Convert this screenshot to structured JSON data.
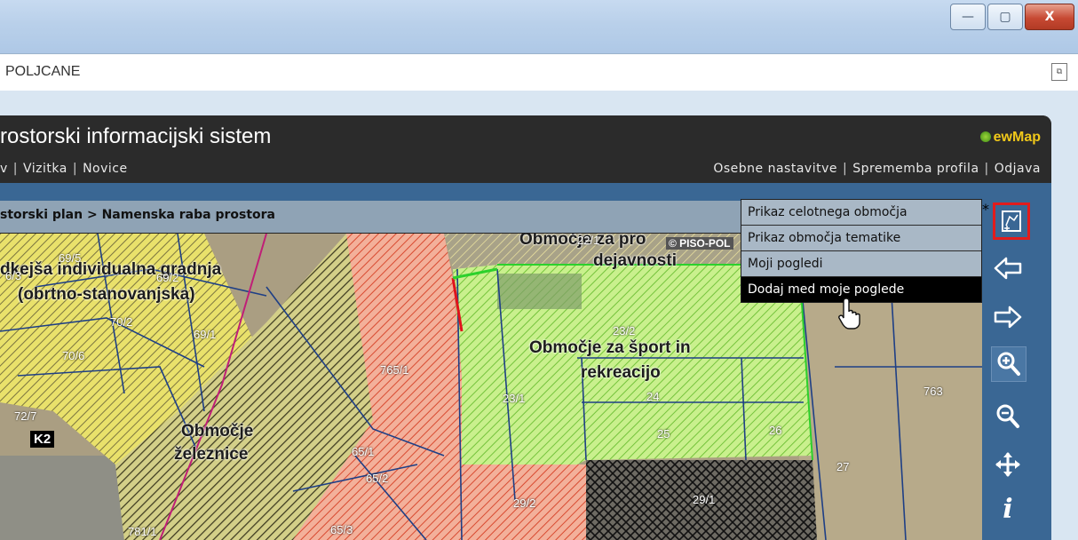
{
  "window": {
    "address": "POLJCANE",
    "minimize": "—",
    "maximize": "▢",
    "close": "X"
  },
  "app": {
    "title": "rostorski informacijski sistem",
    "logo": "ewMap",
    "nav_left": [
      "v",
      "Vizitka",
      "Novice"
    ],
    "nav_right": [
      "Osebne nastavitve",
      "Sprememba profila",
      "Odjava"
    ],
    "breadcrumb": "storski plan > Namenska raba prostora"
  },
  "menu": {
    "items": [
      "Prikaz celotnega območja",
      "Prikaz območja tematike",
      "Moji pogledi",
      "Dodaj med moje poglede"
    ],
    "highlighted": 3
  },
  "map": {
    "zones": {
      "individual": "dkejša individualna gradnja",
      "individual2": "(obrtno-stanovanjska)",
      "sport": "Območje za šport in",
      "sport2": "rekreacijo",
      "railway": "Območje",
      "railway2": "železnice",
      "service": "Območje za pro",
      "service2": "dejavnosti",
      "copyright": "© PISO-POL"
    },
    "parcels": [
      "69/5",
      "6/3",
      "69/2",
      "70/2",
      "69/1",
      "70/6",
      "72/7",
      "765/1",
      "23/2",
      "23/1",
      "24",
      "25",
      "26",
      "763",
      "27",
      "65/1",
      "65/2",
      "29/2",
      "29/1",
      "781/1",
      "65/3",
      "22/1"
    ],
    "marker": "K2"
  },
  "colors": {
    "accent_blue": "#3a6794",
    "highlight_red": "#e21c1c",
    "menu_bg": "#a9b8c6"
  },
  "icons": [
    "zoom-extent-icon",
    "arrow-left-icon",
    "arrow-right-icon",
    "zoom-in-icon",
    "zoom-out-icon",
    "pan-icon",
    "info-icon"
  ]
}
